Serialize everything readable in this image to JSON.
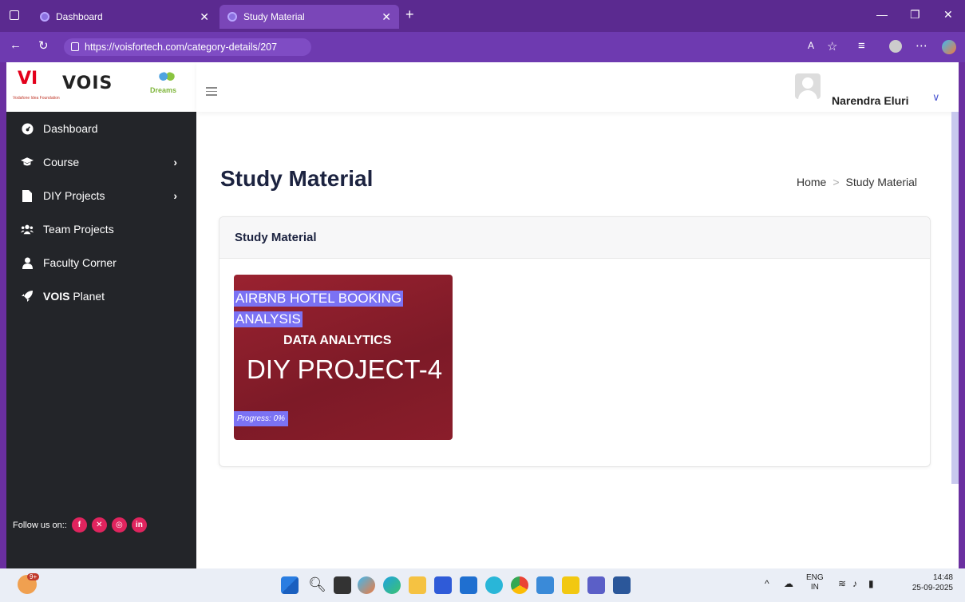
{
  "browser": {
    "tabs": [
      {
        "label": "Dashboard"
      },
      {
        "label": "Study Material",
        "active": true
      }
    ],
    "url": "https://voisfortech.com/category-details/207"
  },
  "logo": {
    "vi": "VI",
    "vi_sub": "Vodafone Idea Foundation",
    "vois": "VOIS",
    "dreams": "Dreams"
  },
  "sidebar": {
    "items": [
      {
        "label": "Dashboard"
      },
      {
        "label": "Course"
      },
      {
        "label": "DIY Projects"
      },
      {
        "label": "Team Projects"
      },
      {
        "label": "Faculty Corner"
      },
      {
        "label_bold": "VOIS",
        "label": " Planet"
      }
    ],
    "follow": "Follow us on::"
  },
  "header": {
    "username": "Narendra Eluri"
  },
  "page": {
    "title": "Study Material",
    "breadcrumb": {
      "home": "Home",
      "current": "Study Material"
    },
    "card_title": "Study Material"
  },
  "project": {
    "title_line1": "AIRBNB HOTEL BOOKING",
    "title_line2": "ANALYSIS",
    "subtitle": "DATA ANALYTICS",
    "name": "DIY PROJECT-4",
    "progress_label": "Progress: 0%"
  },
  "taskbar": {
    "lang1": "ENG",
    "lang2": "IN",
    "time": "14:48",
    "date": "25-09-2025",
    "badge": "9+"
  }
}
